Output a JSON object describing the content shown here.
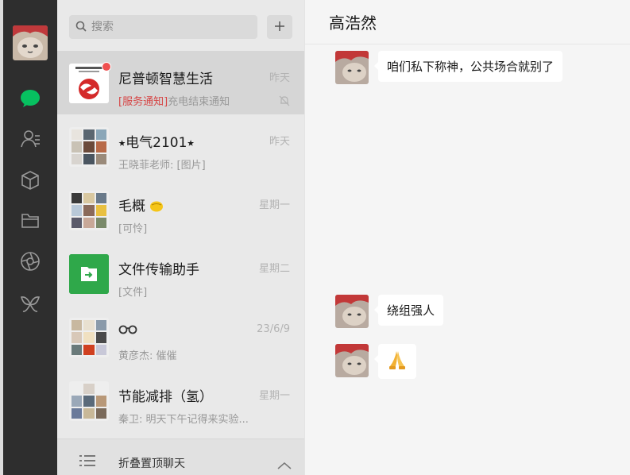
{
  "search": {
    "placeholder": "搜索"
  },
  "chats": [
    {
      "name": "尼普顿智慧生活",
      "time": "昨天",
      "tag": "[服务通知]",
      "preview": "充电结束通知",
      "unread": true,
      "muted": true
    },
    {
      "name": "⭑电气2101⭑",
      "time": "昨天",
      "preview": "王晓菲老师: [图片]"
    },
    {
      "name": "毛概",
      "time": "星期一",
      "preview": "[可怜]"
    },
    {
      "name": "文件传输助手",
      "time": "星期二",
      "preview": "[文件]"
    },
    {
      "name": "",
      "time": "23/6/9",
      "preview": "黄彦杰: 催催"
    },
    {
      "name": "节能减排（氢）",
      "time": "星期一",
      "preview": "秦卫: 明天下午记得来实验..."
    }
  ],
  "fold_bar": {
    "label": "折叠置顶聊天"
  },
  "chat_window": {
    "title": "高浩然",
    "messages": [
      {
        "text": "咱们私下称神，公共场合就别了"
      },
      {
        "text": "绕组强人"
      },
      {
        "text": "🙏",
        "emoji": true
      }
    ]
  },
  "icons": {
    "nav": [
      "chat-icon",
      "contacts-icon",
      "favorites-box-icon",
      "folder-icon",
      "moments-icon",
      "mini-programs-icon"
    ]
  },
  "colors": {
    "accent": "#07c160",
    "sidebar": "#2e2e2e",
    "list_bg": "#e9e9e9",
    "chat_bg": "#f5f5f5",
    "badge": "#f04f4f"
  }
}
